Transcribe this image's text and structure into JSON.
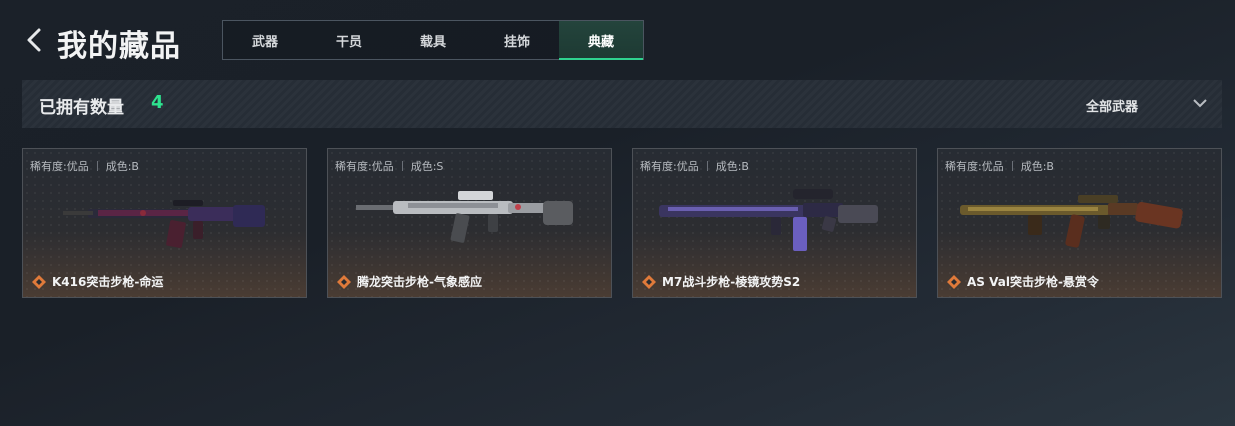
{
  "header": {
    "title": "我的藏品",
    "tabs": [
      {
        "label": "武器",
        "active": false
      },
      {
        "label": "干员",
        "active": false
      },
      {
        "label": "载具",
        "active": false
      },
      {
        "label": "挂饰",
        "active": false
      },
      {
        "label": "典藏",
        "active": true
      }
    ]
  },
  "summary": {
    "owned_label": "已拥有数量",
    "owned_count": "4",
    "filter_label": "全部武器"
  },
  "colors": {
    "accent": "#2ee38f",
    "rarity": "#e07a3a"
  },
  "cards": [
    {
      "rarity": "稀有度:优品",
      "grade": "成色:B",
      "name": "K416突击步枪-命运",
      "icon": "diamond-icon"
    },
    {
      "rarity": "稀有度:优品",
      "grade": "成色:S",
      "name": "腾龙突击步枪-气象感应",
      "icon": "diamond-icon"
    },
    {
      "rarity": "稀有度:优品",
      "grade": "成色:B",
      "name": "M7战斗步枪-棱镜攻势S2",
      "icon": "diamond-icon"
    },
    {
      "rarity": "稀有度:优品",
      "grade": "成色:B",
      "name": "AS Val突击步枪-悬赏令",
      "icon": "diamond-icon"
    }
  ]
}
